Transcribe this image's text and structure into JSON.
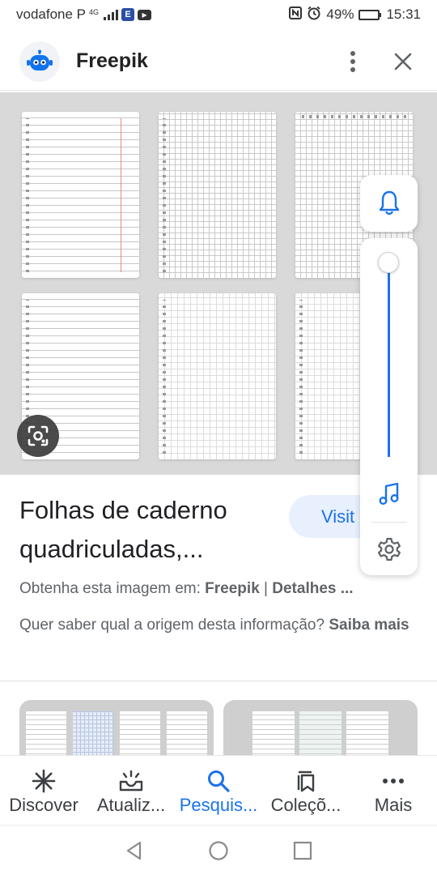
{
  "status_bar": {
    "carrier": "vodafone P",
    "network": "4G",
    "battery": "49%",
    "battery_level": 0.49,
    "time": "15:31"
  },
  "header": {
    "site_name": "Freepik",
    "logo_icon": "freepik-robot-logo"
  },
  "result": {
    "title": "Folhas de caderno\nquadriculadas,...",
    "visit_label": "Visit",
    "source_prefix": "Obtenha esta imagem em: ",
    "source_site": "Freepik",
    "source_separator": " | ",
    "details_label": "Detalhes ...",
    "origin_question": "Quer saber qual a origem desta informação? ",
    "learn_more": "Saiba mais"
  },
  "volume_panel": {
    "level": 0.0,
    "accent": "#1a73e8"
  },
  "bottom_nav": {
    "items": [
      {
        "label": "Discover",
        "icon": "asterisk-icon"
      },
      {
        "label": "Atualiz...",
        "icon": "updates-inbox-icon"
      },
      {
        "label": "Pesquis...",
        "icon": "search-icon",
        "active": true
      },
      {
        "label": "Coleçõ...",
        "icon": "collections-icon"
      },
      {
        "label": "Mais",
        "icon": "more-horiz-icon"
      }
    ]
  },
  "colors": {
    "accent": "#1a73e8",
    "image_bg": "#d9d9d9",
    "visit_bg": "#e8f0fe"
  }
}
